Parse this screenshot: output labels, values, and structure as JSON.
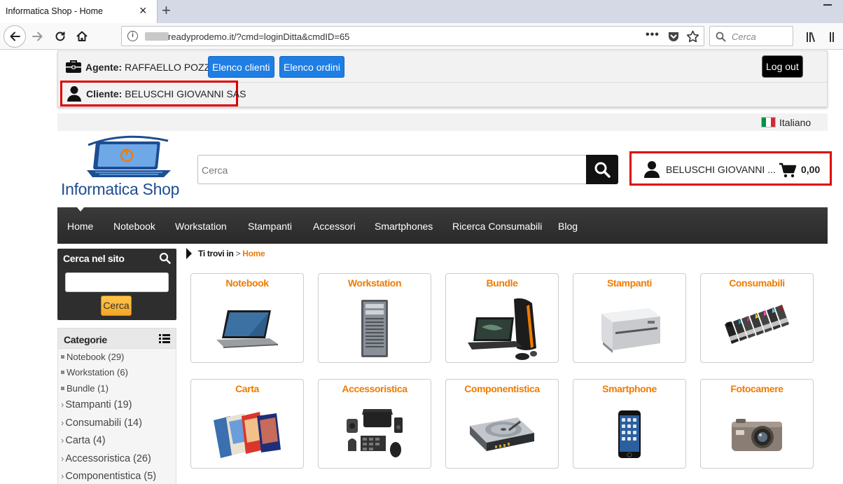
{
  "browser": {
    "tab_title": "Informatica Shop - Home",
    "tab_close": "×",
    "new_tab": "+",
    "url_text": "readyprodemo.it/?cmd=loginDitta&cmdID=65",
    "url_dots": "•••",
    "search_placeholder": "Cerca"
  },
  "agent_bar": {
    "agent_label": "Agente:",
    "agent_name": "RAFFAELLO POZZI",
    "btn_clienti": "Elenco clienti",
    "btn_ordini": "Elenco ordini",
    "logout": "Log out",
    "client_label": "Cliente:",
    "client_name": "BELUSCHI GIOVANNI SAS"
  },
  "language": {
    "label": "Italiano",
    "flag_colors": [
      "#009246",
      "#ffffff",
      "#ce2b37"
    ]
  },
  "header": {
    "logo_text": "Informatica Shop",
    "search_placeholder": "Cerca",
    "user_name": "BELUSCHI GIOVANNI ...",
    "cart_total": "0,00"
  },
  "menu": {
    "items": [
      "Home",
      "Notebook",
      "Workstation",
      "Stampanti",
      "Accessori",
      "Smartphones",
      "Ricerca Consumabili",
      "Blog"
    ]
  },
  "sidebar": {
    "search_title": "Cerca nel sito",
    "search_button": "Cerca",
    "categories_title": "Categorie",
    "categories": [
      "Notebook (29)",
      "Workstation (6)",
      "Bundle (1)",
      "Stampanti (19)",
      "Consumabili (14)",
      "Carta (4)",
      "Accessoristica (26)",
      "Componentistica (5)"
    ]
  },
  "breadcrumb": {
    "prefix": "Ti trovi in",
    "separator": " > ",
    "current": "Home"
  },
  "products": [
    {
      "title": "Notebook",
      "icon": "laptop-image"
    },
    {
      "title": "Workstation",
      "icon": "workstation-image"
    },
    {
      "title": "Bundle",
      "icon": "bundle-image"
    },
    {
      "title": "Stampanti",
      "icon": "printer-image"
    },
    {
      "title": "Consumabili",
      "icon": "ink-cartridges-image"
    },
    {
      "title": "Carta",
      "icon": "paper-image"
    },
    {
      "title": "Accessoristica",
      "icon": "accessories-image"
    },
    {
      "title": "Componentistica",
      "icon": "hard-drive-image"
    },
    {
      "title": "Smartphone",
      "icon": "smartphone-image"
    },
    {
      "title": "Fotocamere",
      "icon": "camera-image"
    }
  ],
  "colors": {
    "accent_orange": "#f07b00",
    "highlight_red": "#e00000",
    "button_blue": "#1e7ee4",
    "menu_dark": "#2f2f2f",
    "logo_blue": "#1d4d92"
  }
}
